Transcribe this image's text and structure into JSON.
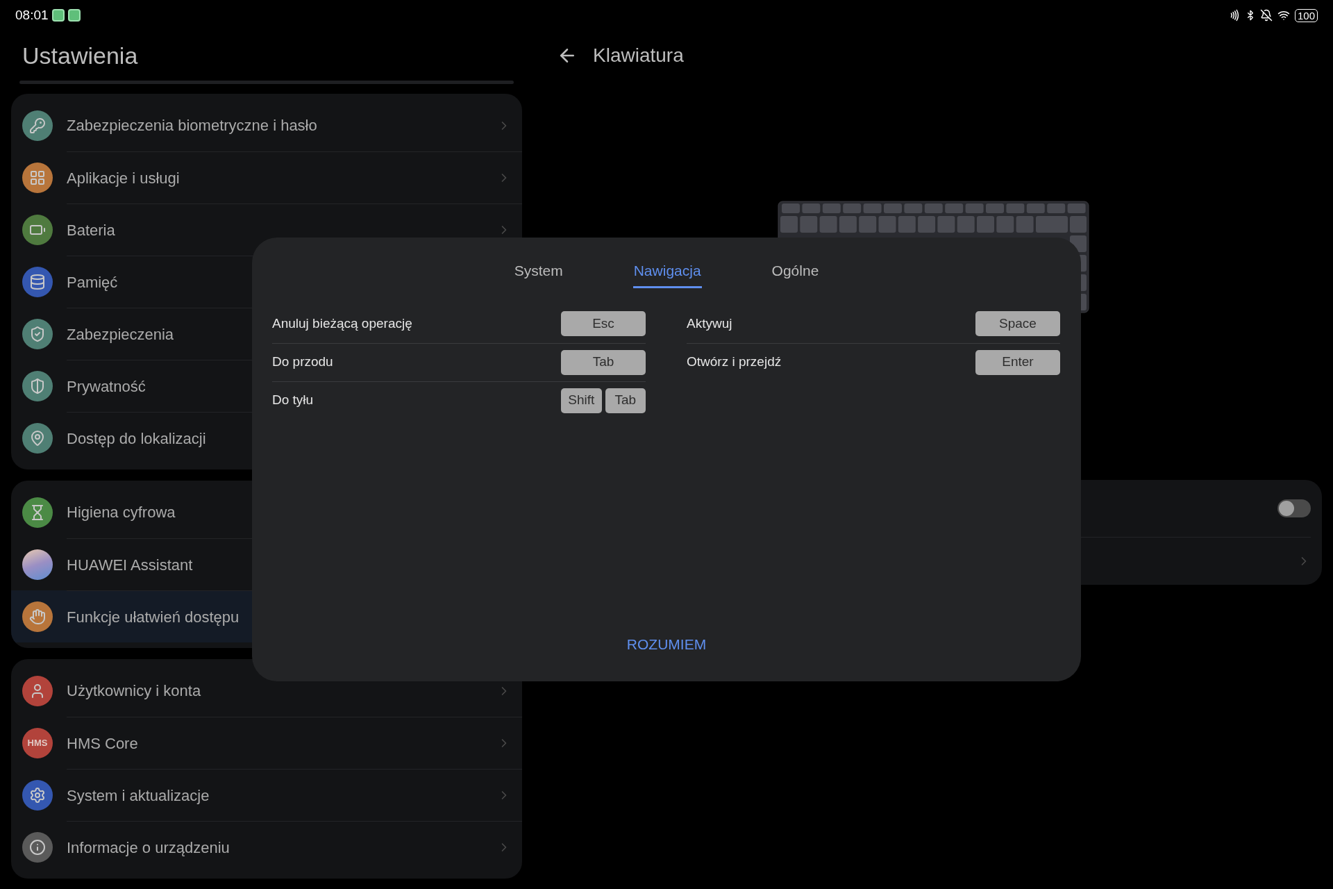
{
  "status_bar": {
    "time": "08:01",
    "notifications": [
      {
        "kind": "app"
      },
      {
        "kind": "app"
      }
    ],
    "battery": "100"
  },
  "sidebar": {
    "title": "Ustawienia",
    "groups": [
      {
        "items": [
          {
            "label": "Zabezpieczenia biometryczne i hasło",
            "kind": "key",
            "color": "#4f7f74",
            "selected": false
          },
          {
            "label": "Aplikacje i usługi",
            "kind": "apps",
            "color": "#b8753b",
            "selected": false
          },
          {
            "label": "Bateria",
            "kind": "battery",
            "color": "#4f7a3f",
            "selected": false
          },
          {
            "label": "Pamięć",
            "kind": "storage",
            "color": "#3457b0",
            "selected": false
          },
          {
            "label": "Zabezpieczenia",
            "kind": "shield",
            "color": "#4f7f74",
            "selected": false
          },
          {
            "label": "Prywatność",
            "kind": "privacy",
            "color": "#4f7f74",
            "selected": false
          },
          {
            "label": "Dostęp do lokalizacji",
            "kind": "location",
            "color": "#4f7f74",
            "selected": false
          }
        ]
      },
      {
        "items": [
          {
            "label": "Higiena cyfrowa",
            "kind": "hourglass",
            "color": "#4b8a45",
            "selected": false
          },
          {
            "label": "HUAWEI Assistant",
            "kind": "assistant",
            "selected": false
          },
          {
            "label": "Funkcje ułatwień dostępu",
            "kind": "hand",
            "color": "#b8753b",
            "selected": true
          }
        ]
      },
      {
        "items": [
          {
            "label": "Użytkownicy i konta",
            "kind": "user",
            "color": "#b2433b",
            "selected": false
          },
          {
            "label": "HMS Core",
            "kind": "text",
            "icon_text": "HMS",
            "color": "#b2433b",
            "selected": false
          },
          {
            "label": "System i aktualizacje",
            "kind": "gear",
            "color": "#3457b0",
            "selected": false
          },
          {
            "label": "Informacje o urządzeniu",
            "kind": "info",
            "color": "#5a5a5a",
            "selected": false
          }
        ]
      }
    ]
  },
  "detail": {
    "title": "Klawiatura",
    "settings_card": {
      "toggle": {
        "on": false
      }
    }
  },
  "dialog": {
    "tabs": [
      {
        "label": "System",
        "selected": false
      },
      {
        "label": "Nawigacja",
        "selected": true
      },
      {
        "label": "Ogólne",
        "selected": false
      }
    ],
    "columns": [
      [
        {
          "label": "Anuluj bieżącą operację",
          "keys": [
            "Esc"
          ]
        },
        {
          "label": "Do przodu",
          "keys": [
            "Tab"
          ]
        },
        {
          "label": "Do tyłu",
          "keys": [
            "Shift",
            "Tab"
          ]
        }
      ],
      [
        {
          "label": "Aktywuj",
          "keys": [
            "Space"
          ]
        },
        {
          "label": "Otwórz i przejdź",
          "keys": [
            "Enter"
          ]
        }
      ]
    ],
    "confirm": "ROZUMIEM"
  }
}
